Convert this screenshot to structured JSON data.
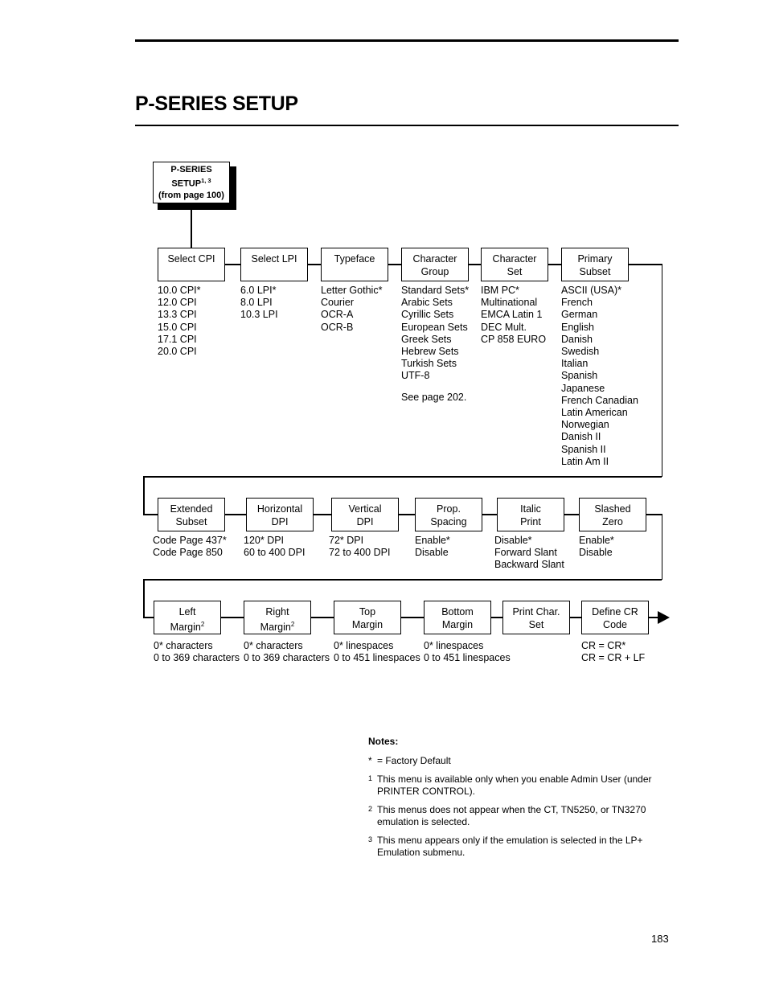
{
  "document": {
    "title": "P-SERIES SETUP",
    "page_number": "183"
  },
  "root": {
    "line1": "P-SERIES",
    "line2": "SETUP",
    "line2_sup": "1, 3",
    "line3": "(from page 100)"
  },
  "rows": [
    {
      "id": "row1",
      "boxes": [
        {
          "name": "select-cpi",
          "title_line1": "Select CPI",
          "title_line2": "",
          "sup": "",
          "options": [
            "10.0 CPI*",
            "12.0 CPI",
            "13.3 CPI",
            "15.0 CPI",
            "17.1 CPI",
            "20.0 CPI"
          ]
        },
        {
          "name": "select-lpi",
          "title_line1": "Select LPI",
          "title_line2": "",
          "sup": "",
          "options": [
            "6.0 LPI*",
            "8.0 LPI",
            "10.3 LPI"
          ]
        },
        {
          "name": "typeface",
          "title_line1": "Typeface",
          "title_line2": "",
          "sup": "",
          "options": [
            "Letter Gothic*",
            "Courier",
            "OCR-A",
            "OCR-B"
          ]
        },
        {
          "name": "character-group",
          "title_line1": "Character",
          "title_line2": "Group",
          "sup": "",
          "options": [
            "Standard Sets*",
            "Arabic Sets",
            "Cyrillic Sets",
            "European Sets",
            "Greek Sets",
            "Hebrew Sets",
            "Turkish Sets",
            "UTF-8",
            "",
            "See page 202."
          ]
        },
        {
          "name": "character-set",
          "title_line1": "Character",
          "title_line2": "Set",
          "sup": "",
          "options": [
            "IBM PC*",
            "Multinational",
            "EMCA Latin 1",
            "DEC Mult.",
            "CP 858 EURO"
          ]
        },
        {
          "name": "primary-subset",
          "title_line1": "Primary",
          "title_line2": "Subset",
          "sup": "",
          "options": [
            "ASCII (USA)*",
            "French",
            "German",
            "English",
            "Danish",
            "Swedish",
            "Italian",
            "Spanish",
            "Japanese",
            "French Canadian",
            "Latin American",
            "Norwegian",
            "Danish II",
            "Spanish II",
            "Latin Am II"
          ]
        }
      ]
    },
    {
      "id": "row2",
      "boxes": [
        {
          "name": "extended-subset",
          "title_line1": "Extended",
          "title_line2": "Subset",
          "sup": "",
          "options": [
            "Code Page 437*",
            "Code Page 850"
          ]
        },
        {
          "name": "horizontal-dpi",
          "title_line1": "Horizontal",
          "title_line2": "DPI",
          "sup": "",
          "options": [
            "120* DPI",
            "60 to 400 DPI"
          ]
        },
        {
          "name": "vertical-dpi",
          "title_line1": "Vertical",
          "title_line2": "DPI",
          "sup": "",
          "options": [
            "72* DPI",
            "72 to 400 DPI"
          ]
        },
        {
          "name": "prop-spacing",
          "title_line1": "Prop.",
          "title_line2": "Spacing",
          "sup": "",
          "options": [
            "Enable*",
            "Disable"
          ]
        },
        {
          "name": "italic-print",
          "title_line1": "Italic",
          "title_line2": "Print",
          "sup": "",
          "options": [
            "Disable*",
            "Forward Slant",
            "Backward Slant"
          ]
        },
        {
          "name": "slashed-zero",
          "title_line1": "Slashed",
          "title_line2": "Zero",
          "sup": "",
          "options": [
            "Enable*",
            "Disable"
          ]
        }
      ]
    },
    {
      "id": "row3",
      "boxes": [
        {
          "name": "left-margin",
          "title_line1": "Left",
          "title_line2": "Margin",
          "sup": "2",
          "options": [
            "0* characters",
            "0 to 369 characters"
          ]
        },
        {
          "name": "right-margin",
          "title_line1": "Right",
          "title_line2": "Margin",
          "sup": "2",
          "options": [
            "0* characters",
            "0 to 369 characters"
          ]
        },
        {
          "name": "top-margin",
          "title_line1": "Top",
          "title_line2": "Margin",
          "sup": "",
          "options": [
            "0* linespaces",
            "0 to 451 linespaces"
          ]
        },
        {
          "name": "bottom-margin",
          "title_line1": "Bottom",
          "title_line2": "Margin",
          "sup": "",
          "options": [
            "0* linespaces",
            "0 to 451 linespaces"
          ]
        },
        {
          "name": "print-char-set",
          "title_line1": "Print Char.",
          "title_line2": "Set",
          "sup": "",
          "options": []
        },
        {
          "name": "define-cr-code",
          "title_line1": "Define CR",
          "title_line2": "Code",
          "sup": "",
          "options": [
            "CR = CR*",
            "CR = CR + LF"
          ]
        }
      ]
    }
  ],
  "notes": {
    "heading": "Notes:",
    "items": [
      {
        "mark": "*",
        "text": "= Factory Default"
      },
      {
        "mark": "1",
        "text": "This menu is available only when you enable Admin User (under PRINTER CONTROL)."
      },
      {
        "mark": "2",
        "text": "This menus does not appear when the CT, TN5250, or TN3270 emulation is selected."
      },
      {
        "mark": "3",
        "text": "This menu appears only if the emulation is selected in the LP+ Emulation submenu."
      }
    ]
  }
}
